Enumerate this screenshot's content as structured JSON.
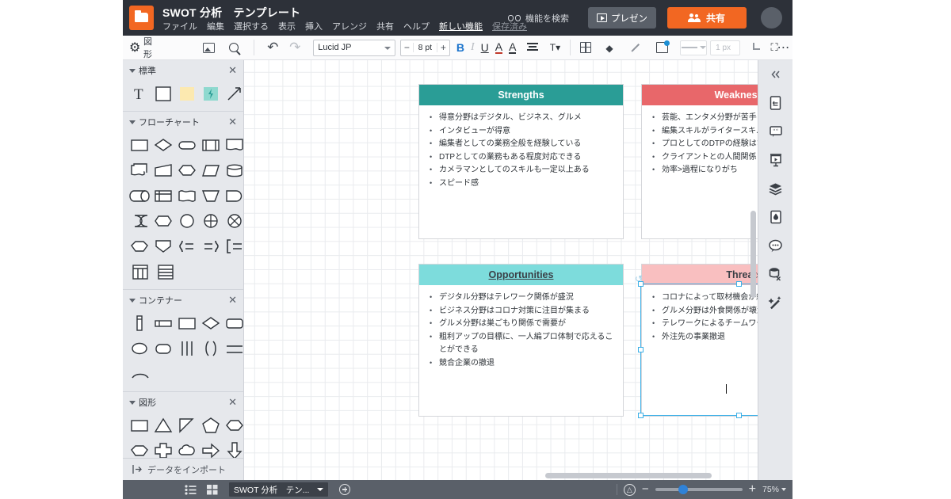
{
  "window": {
    "document_title": "SWOT 分析　テンプレート",
    "menu": [
      {
        "label": "ファイル",
        "style": "normal"
      },
      {
        "label": "編集",
        "style": "normal"
      },
      {
        "label": "選択する",
        "style": "normal"
      },
      {
        "label": "表示",
        "style": "normal"
      },
      {
        "label": "挿入",
        "style": "normal"
      },
      {
        "label": "アレンジ",
        "style": "normal"
      },
      {
        "label": "共有",
        "style": "normal"
      },
      {
        "label": "ヘルプ",
        "style": "normal"
      },
      {
        "label": "新しい機能",
        "style": "link"
      },
      {
        "label": "保存済み",
        "style": "saved"
      }
    ],
    "search_features_label": "機能を検索",
    "search_features_icon": "binoculars-icon",
    "present_label": "プレゼン",
    "present_icon": "play-icon",
    "share_label": "共有",
    "share_icon": "people-icon",
    "avatar_icon": "avatar",
    "logo_icon": "lucid-folder-logo",
    "accent_color": "#f26722",
    "topbar_color": "#2d3139"
  },
  "toolbar": {
    "shapes_label": "図形",
    "shapes_icon": "gear-icon",
    "image_icon": "image-icon",
    "search_icon": "search-icon",
    "undo_icon": "undo-arrow-icon",
    "redo_icon": "redo-arrow-icon",
    "font_family": "Lucid JP",
    "font_size": "8 pt",
    "font_size_minus": "−",
    "font_size_plus": "+",
    "bold_label": "B",
    "italic_label": "I",
    "underline_label": "U",
    "text_color_label": "A",
    "fill_color_label": "A",
    "align_icon": "text-align-icon",
    "text_options_label": "T",
    "grid_icon": "grid-icon",
    "fill_icon": "fill-bucket-icon",
    "line_icon": "pen-line-icon",
    "shadow_icon": "shadow-icon",
    "line_weight": "1 px",
    "elbow_icon": "elbow-connector-icon",
    "more_icon": "more-dots-icon",
    "fullscreen_icon": "fullscreen-icon"
  },
  "left_panel": {
    "groups": [
      {
        "title": "標準",
        "close_icon": "close-icon",
        "shapes": [
          {
            "name": "text-shape",
            "glyph": "T"
          },
          {
            "name": "rectangle-shape",
            "glyph": "square"
          },
          {
            "name": "sticky-note-shape",
            "glyph": "note"
          },
          {
            "name": "action-shape",
            "glyph": "bolt"
          },
          {
            "name": "line-arrow-shape",
            "glyph": "arrow"
          }
        ]
      },
      {
        "title": "フローチャート",
        "close_icon": "close-icon",
        "shapes": [
          {
            "name": "process-shape",
            "glyph": "rect"
          },
          {
            "name": "decision-shape",
            "glyph": "diamond"
          },
          {
            "name": "terminator-shape",
            "glyph": "stadium"
          },
          {
            "name": "predefined-process-shape",
            "glyph": "rect-bars"
          },
          {
            "name": "document-shape",
            "glyph": "doc"
          },
          {
            "name": "multidocument-shape",
            "glyph": "multidoc"
          },
          {
            "name": "manual-input-shape",
            "glyph": "manual-input"
          },
          {
            "name": "preparation-shape",
            "glyph": "hexagon"
          },
          {
            "name": "data-shape",
            "glyph": "parallelogram"
          },
          {
            "name": "database-shape",
            "glyph": "cylinder"
          },
          {
            "name": "direct-access-shape",
            "glyph": "direct-access"
          },
          {
            "name": "internal-storage-shape",
            "glyph": "internal-storage"
          },
          {
            "name": "paper-tape-shape",
            "glyph": "paper-tape"
          },
          {
            "name": "manual-operation-shape",
            "glyph": "trapezoid"
          },
          {
            "name": "delay-shape",
            "glyph": "delay"
          },
          {
            "name": "stored-data-shape",
            "glyph": "stored-data"
          },
          {
            "name": "display-shape",
            "glyph": "display"
          },
          {
            "name": "connector-shape",
            "glyph": "circle"
          },
          {
            "name": "summing-junction-shape",
            "glyph": "circle-plus"
          },
          {
            "name": "or-shape",
            "glyph": "circle-x"
          },
          {
            "name": "collate-shape",
            "glyph": "octagon"
          },
          {
            "name": "extract-shape",
            "glyph": "shield"
          },
          {
            "name": "merge-brace-shape",
            "glyph": "brace-right"
          },
          {
            "name": "sort-brace-shape",
            "glyph": "brace-left"
          },
          {
            "name": "bracket-shape",
            "glyph": "bracket"
          },
          {
            "name": "table-columns-shape",
            "glyph": "table-cols"
          },
          {
            "name": "table-rows-shape",
            "glyph": "table-rows"
          }
        ]
      },
      {
        "title": "コンテナー",
        "close_icon": "close-icon",
        "shapes": [
          {
            "name": "vertical-bar-container",
            "glyph": "vbar"
          },
          {
            "name": "horizontal-bar-container",
            "glyph": "hbar"
          },
          {
            "name": "rect-container",
            "glyph": "rect"
          },
          {
            "name": "diamond-container",
            "glyph": "diamond"
          },
          {
            "name": "rounded-container",
            "glyph": "rounded"
          },
          {
            "name": "ellipse-container",
            "glyph": "ellipse"
          },
          {
            "name": "pill-container",
            "glyph": "pill"
          },
          {
            "name": "pipes-container",
            "glyph": "pipes"
          },
          {
            "name": "parens-container",
            "glyph": "parens"
          },
          {
            "name": "lines-container",
            "glyph": "lines"
          },
          {
            "name": "arc-container",
            "glyph": "arc"
          }
        ]
      },
      {
        "title": "図形",
        "close_icon": "close-icon",
        "shapes": [
          {
            "name": "rectangle-shape",
            "glyph": "rect"
          },
          {
            "name": "triangle-shape",
            "glyph": "triangle"
          },
          {
            "name": "right-triangle-shape",
            "glyph": "right-triangle"
          },
          {
            "name": "pentagon-shape",
            "glyph": "pentagon"
          },
          {
            "name": "hexagon-shape",
            "glyph": "hexagon"
          },
          {
            "name": "octagon-shape",
            "glyph": "octagon"
          },
          {
            "name": "cross-shape",
            "glyph": "cross"
          },
          {
            "name": "cloud-shape",
            "glyph": "cloud"
          },
          {
            "name": "arrow-right-shape",
            "glyph": "arrow-right"
          },
          {
            "name": "arrow-down-shape",
            "glyph": "arrow-down"
          },
          {
            "name": "arrow-left-shape",
            "glyph": "arrow-left"
          },
          {
            "name": "arrow-up-shape",
            "glyph": "arrow-up"
          },
          {
            "name": "arrow-lr-shape",
            "glyph": "arrow-lr"
          },
          {
            "name": "arrow-ud-shape",
            "glyph": "arrow-ud"
          },
          {
            "name": "circle-shape",
            "glyph": "circle"
          }
        ]
      }
    ],
    "import_label": "データをインポート",
    "import_icon": "import-icon"
  },
  "canvas": {
    "quadrants": [
      {
        "id": "strengths",
        "title": "Strengths",
        "header_color": "#2a9d96",
        "title_color": "#ffffff",
        "underline": false,
        "items": [
          "得意分野はデジタル、ビジネス、グルメ",
          "インタビューが得意",
          "編集者としての業務全般を経験している",
          "DTPとしての業務もある程度対応できる",
          "カメラマンとしてのスキルも一定以上ある",
          "スピード感"
        ]
      },
      {
        "id": "weaknesses",
        "title": "Weaknesses",
        "header_color": "#e8676a",
        "title_color": "#ffffff",
        "underline": false,
        "items": [
          "芸能、エンタメ分野が苦手",
          "編集スキルがライタースキルに見劣る",
          "プロとしてのDTPの経験はない",
          "クライアントとの人間関係",
          "効率>過程になりがち"
        ]
      },
      {
        "id": "opportunities",
        "title": "Opportunities",
        "header_color": "#7ddcdc",
        "title_color": "#2e3338",
        "underline": true,
        "items": [
          "デジタル分野はテレワーク関係が盛況",
          "ビジネス分野はコロナ対策に注目が集まる",
          "グルメ分野は巣ごもり関係で需要が",
          "粗利アップの目標に、一人編プロ体制で応えることができる",
          "競合企業の撤退"
        ]
      },
      {
        "id": "threats",
        "title": "Threats",
        "header_color": "#f9bfc0",
        "title_color": "#2e3338",
        "underline": false,
        "selected": true,
        "items": [
          "コロナによって取材機会が縮小傾向",
          "グルメ分野は外食関係が壊滅的",
          "テレワークによるチームワークの低下",
          "外注先の事業撤退"
        ]
      }
    ],
    "selection_color": "#3eb1e8",
    "rotate_icon": "rotate-handle-icon",
    "h_scrollbar": "horizontal-scrollbar",
    "v_scrollbar": "vertical-scrollbar"
  },
  "right_rail": {
    "collapse_icon": "chevron-double-left-icon",
    "items": [
      {
        "name": "document-properties-icon"
      },
      {
        "name": "notes-icon"
      },
      {
        "name": "presentation-icon"
      },
      {
        "name": "layers-icon"
      },
      {
        "name": "theme-icon"
      },
      {
        "name": "comments-icon"
      },
      {
        "name": "data-link-icon"
      },
      {
        "name": "magic-wand-icon"
      }
    ]
  },
  "bottom_bar": {
    "list_view_icon": "list-view-icon",
    "grid_view_icon": "grid-view-icon",
    "page_tab_label": "SWOT 分析　テン...",
    "page_tab_caret": "chevron-down-icon",
    "add_page_icon": "plus-circle-icon",
    "fit_icon": "fit-to-screen-icon",
    "zoom_out_label": "−",
    "zoom_in_label": "+",
    "zoom_level": "75%",
    "zoom_caret": "chevron-down-icon",
    "zoom_slider_percent": 32
  }
}
